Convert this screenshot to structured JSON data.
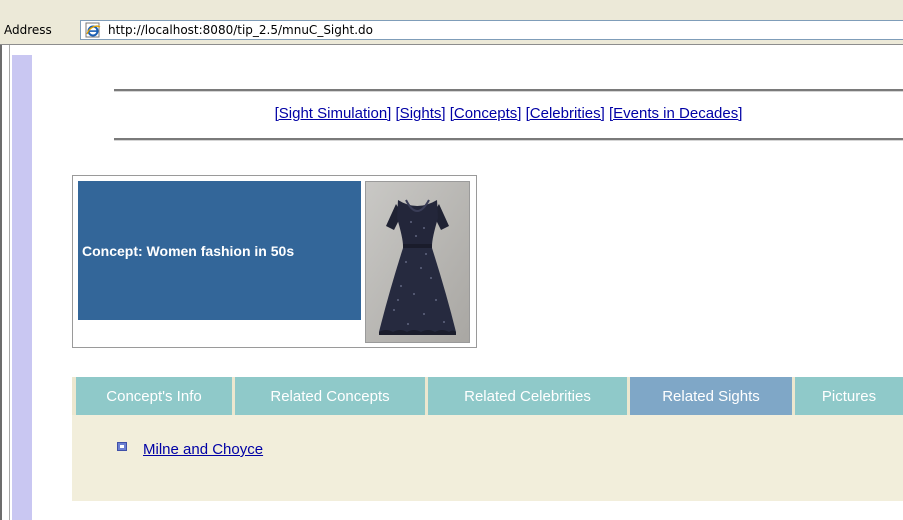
{
  "browser": {
    "address_label": "Address",
    "url": "http://localhost:8080/tip_2.5/mnuC_Sight.do"
  },
  "nav": {
    "links": [
      "[Sight Simulation]",
      "[Sights]",
      "[Concepts]",
      "[Celebrities]",
      "[Events in Decades]"
    ]
  },
  "concept": {
    "title": "Concept: Women fashion in 50s",
    "photo_icon": "dress-photo"
  },
  "tabs": [
    {
      "label": "Concept's Info",
      "active": false
    },
    {
      "label": "Related Concepts",
      "active": false
    },
    {
      "label": "Related Celebrities",
      "active": false
    },
    {
      "label": "Related Sights",
      "active": true
    },
    {
      "label": "Pictures",
      "active": false
    }
  ],
  "related_sights": [
    "Milne and Choyce"
  ],
  "colors": {
    "concept_bg": "#336699",
    "tab_bg": "#8fc9c9",
    "tab_active_bg": "#7fa7c7",
    "link": "#0000a5",
    "sidebar": "#c9c7f2"
  }
}
